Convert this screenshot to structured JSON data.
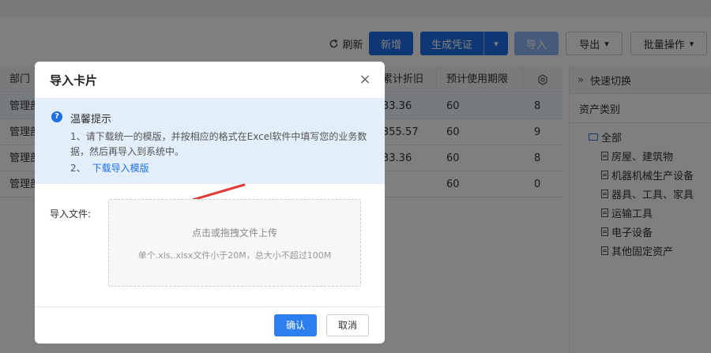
{
  "toolbar": {
    "refresh_label": "刷新",
    "add_label": "新增",
    "generate_label": "生成凭证",
    "import_label": "导入",
    "export_label": "导出",
    "batch_label": "批量操作"
  },
  "table": {
    "headers": [
      "部门",
      "累计折旧",
      "预计使用期限"
    ],
    "rows": [
      {
        "dept": "管理部",
        "depr": "33.36",
        "life": "60",
        "last": "8"
      },
      {
        "dept": "管理部",
        "depr": "355.57",
        "life": "60",
        "last": "9"
      },
      {
        "dept": "管理部",
        "depr": "33.36",
        "life": "60",
        "last": "8"
      },
      {
        "dept": "管理部",
        "depr": "",
        "life": "60",
        "last": "0"
      }
    ]
  },
  "right_panel": {
    "quick_switch": "快速切换",
    "category_title": "资产类别",
    "root": "全部",
    "items": [
      "房屋、建筑物",
      "机器机械生产设备",
      "器具、工具、家具",
      "运输工具",
      "电子设备",
      "其他固定资产"
    ]
  },
  "dialog": {
    "title": "导入卡片",
    "close": "×",
    "tip_title": "温馨提示",
    "tip_line1": "1、请下载统一的模版，并按相应的格式在Excel软件中填写您的业务数据，然后再导入到系统中。",
    "tip_line2_prefix": "2、",
    "tip_link": "下载导入模版",
    "upload_label": "导入文件:",
    "drop_main": "点击或拖拽文件上传",
    "drop_sub": "单个.xls,.xlsx文件小于20M，总大小不超过100M",
    "ok": "确认",
    "cancel": "取消"
  },
  "colors": {
    "primary": "#1e6fe8",
    "tip_bg": "#e3eefb",
    "arrow": "#e53935"
  }
}
